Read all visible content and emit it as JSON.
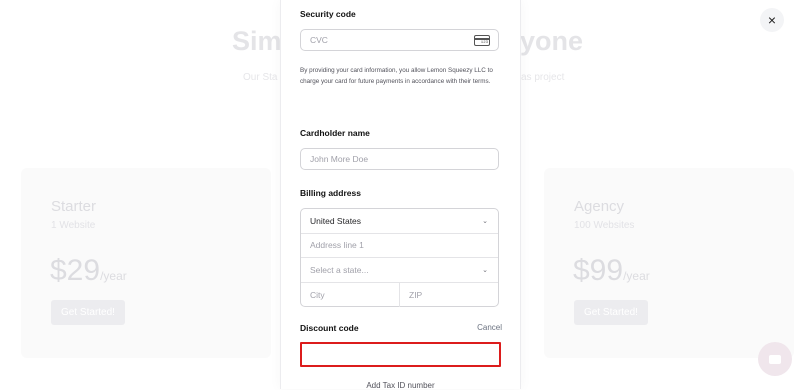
{
  "background": {
    "headline_left": "Sim",
    "headline_right": "yone",
    "sub_left": "Our Sta",
    "sub_right": "as project",
    "plans": [
      {
        "name": "Starter",
        "sites": "1 Website",
        "price": "$29",
        "period": "/year",
        "cta": "Get Started!"
      },
      {
        "name": "Agency",
        "sites": "100 Websites",
        "price": "$99",
        "period": "/year",
        "cta": "Get Started!"
      }
    ]
  },
  "modal": {
    "security_code": {
      "label": "Security code",
      "placeholder": "CVC",
      "icon": "card-cvc-icon",
      "icon_text": "123"
    },
    "disclaimer": "By providing your card information, you allow Lemon Squeezy LLC to charge your card for future payments in accordance with their terms.",
    "cardholder": {
      "label": "Cardholder name",
      "placeholder": "John More Doe"
    },
    "billing": {
      "label": "Billing address",
      "country": "United States",
      "address_placeholder": "Address line 1",
      "state_placeholder": "Select a state...",
      "city_placeholder": "City",
      "zip_placeholder": "ZIP"
    },
    "discount": {
      "label": "Discount code",
      "cancel": "Cancel",
      "value": ""
    },
    "tax_id_link": "Add Tax ID number"
  },
  "close_icon": "×",
  "colors": {
    "accent_border": "#dc1c1c",
    "chat_bubble": "#f0e6ec"
  }
}
